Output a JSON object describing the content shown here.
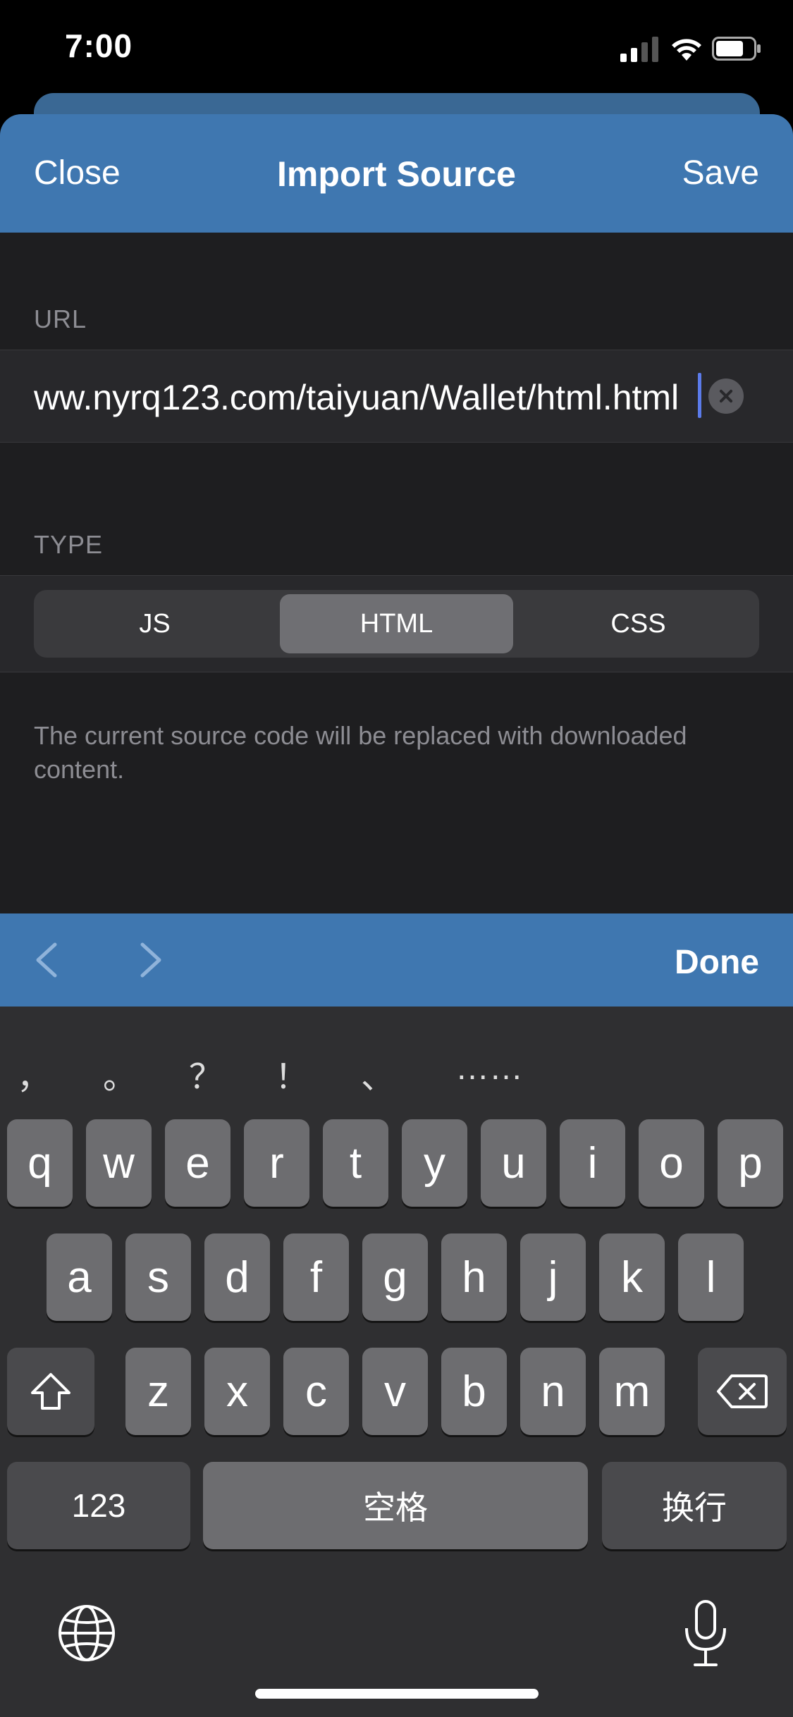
{
  "status_bar": {
    "time": "7:00"
  },
  "nav": {
    "close": "Close",
    "title": "Import Source",
    "save": "Save"
  },
  "url_section": {
    "label": "URL",
    "value": "ww.nyrq123.com/taiyuan/Wallet/html.html"
  },
  "type_section": {
    "label": "TYPE",
    "options": [
      "JS",
      "HTML",
      "CSS"
    ],
    "selected": "HTML"
  },
  "note": "The current source code will be replaced with downloaded content.",
  "toolbar": {
    "done": "Done"
  },
  "keyboard": {
    "candidates": [
      "，",
      "。",
      "？",
      "！",
      "、",
      "……"
    ],
    "row1": [
      "q",
      "w",
      "e",
      "r",
      "t",
      "y",
      "u",
      "i",
      "o",
      "p"
    ],
    "row2": [
      "a",
      "s",
      "d",
      "f",
      "g",
      "h",
      "j",
      "k",
      "l"
    ],
    "row3": [
      "z",
      "x",
      "c",
      "v",
      "b",
      "n",
      "m"
    ],
    "numbers_key": "123",
    "space_key": "空格",
    "return_key": "换行"
  },
  "colors": {
    "accent": "#3f77b0",
    "sheet_bg": "#1e1e20",
    "row_bg": "#28282b",
    "key": "#6d6d70",
    "key_dark": "#4a4a4d"
  }
}
